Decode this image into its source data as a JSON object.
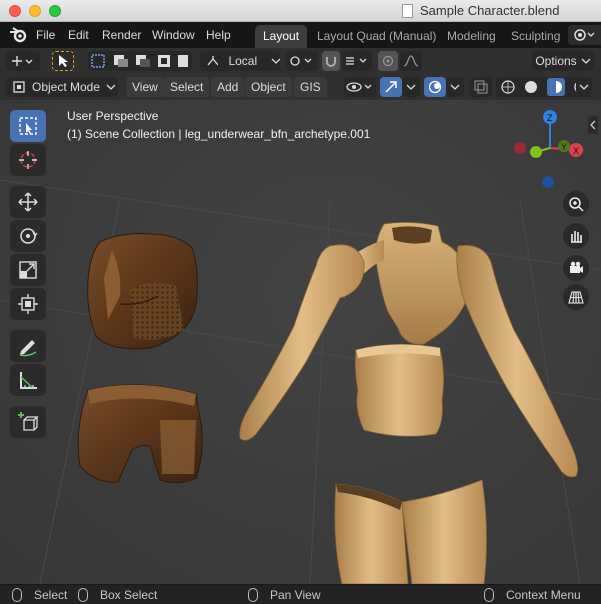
{
  "window": {
    "title": "Sample Character.blend"
  },
  "menu": {
    "file": "File",
    "edit": "Edit",
    "render": "Render",
    "window": "Window",
    "help": "Help"
  },
  "workspaces": [
    "Layout",
    "Layout Quad (Manual)",
    "Modeling",
    "Sculpting"
  ],
  "header": {
    "transform_orientation": "Local",
    "options": "Options",
    "mode": "Object Mode",
    "view": "View",
    "select": "Select",
    "add": "Add",
    "object": "Object",
    "gis": "GIS"
  },
  "viewport": {
    "perspective": "User Perspective",
    "collection": "(1) Scene Collection | leg_underwear_bfn_archetype.001"
  },
  "gizmo": {
    "x": "X",
    "y": "Y",
    "z": "Z"
  },
  "statusbar": {
    "select": "Select",
    "box_select": "Box Select",
    "pan_view": "Pan View",
    "context_menu": "Context Menu"
  },
  "colors": {
    "accent": "#4772b3",
    "x_axis": "#e0404e",
    "y_axis": "#80c020",
    "z_axis": "#2f80e0"
  }
}
